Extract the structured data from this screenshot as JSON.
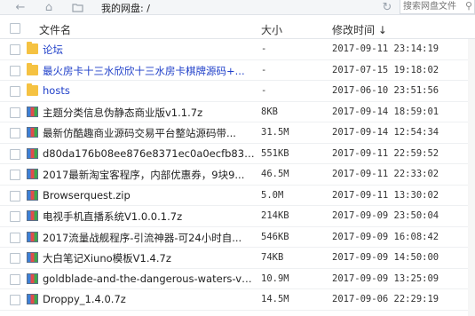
{
  "toolbar": {
    "path_label": "我的网盘: /",
    "search_placeholder": "搜索网盘文件"
  },
  "icons": {
    "back": "arrow-left",
    "home": "house",
    "folder_nav": "folder",
    "refresh": "refresh",
    "search": "magnifier"
  },
  "columns": {
    "name": "文件名",
    "size": "大小",
    "modified": "修改时间 ↓"
  },
  "files": [
    {
      "type": "folder",
      "name": "论坛",
      "size": "-",
      "modified": "2017-09-11 23:14:19",
      "link": true
    },
    {
      "type": "folder",
      "name": "最火房卡十三水欣欣十三水房卡棋牌源码+...",
      "size": "-",
      "modified": "2017-07-15 19:18:02",
      "link": true
    },
    {
      "type": "folder",
      "name": "hosts",
      "size": "-",
      "modified": "2017-06-10 23:51:56",
      "link": true
    },
    {
      "type": "archive",
      "name": "主题分类信息伪静态商业版v1.1.7z",
      "size": "8KB",
      "modified": "2017-09-14 18:59:01",
      "link": false
    },
    {
      "type": "archive",
      "name": "最新仿酷趣商业源码交易平台整站源码带...",
      "size": "31.5M",
      "modified": "2017-09-14 12:54:34",
      "link": false
    },
    {
      "type": "archive",
      "name": "d80da176b08ee876e8371ec0a0ecfb83.rar",
      "size": "551KB",
      "modified": "2017-09-11 22:59:52",
      "link": false
    },
    {
      "type": "archive",
      "name": "2017最新淘宝客程序，内部优惠券，9块9...",
      "size": "46.5M",
      "modified": "2017-09-11 22:33:02",
      "link": false
    },
    {
      "type": "archive",
      "name": "Browserquest.zip",
      "size": "5.0M",
      "modified": "2017-09-11 13:30:02",
      "link": false
    },
    {
      "type": "archive",
      "name": "电视手机直播系统V1.0.0.1.7z",
      "size": "214KB",
      "modified": "2017-09-09 23:50:04",
      "link": false
    },
    {
      "type": "archive",
      "name": "2017流量战舰程序-引流神器-可24小时自...",
      "size": "546KB",
      "modified": "2017-09-09 16:08:42",
      "link": false
    },
    {
      "type": "archive",
      "name": "大白笔记Xiuno模板V1.4.7z",
      "size": "74KB",
      "modified": "2017-09-09 14:50:00",
      "link": false
    },
    {
      "type": "archive",
      "name": "goldblade-and-the-dangerous-waters-v1...",
      "size": "10.9M",
      "modified": "2017-09-09 13:25:09",
      "link": false
    },
    {
      "type": "archive",
      "name": "Droppy_1.4.0.7z",
      "size": "14.5M",
      "modified": "2017-09-06 22:29:19",
      "link": false
    }
  ]
}
